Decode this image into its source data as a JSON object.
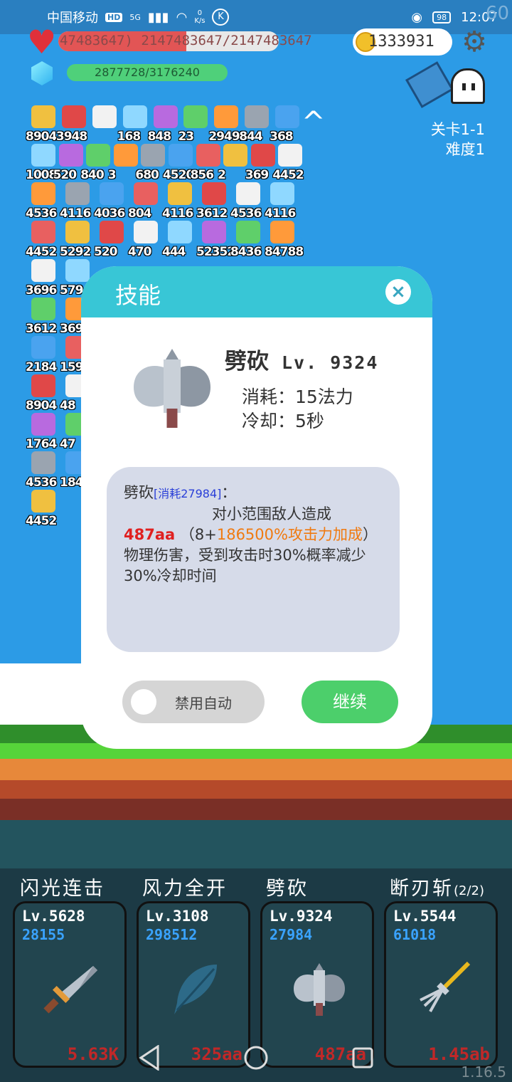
{
  "status_bar": {
    "carrier": "中国移动",
    "hd": "HD",
    "net": "5G",
    "speed": "0",
    "speed_unit": "K/s",
    "battery": "98",
    "time": "12:07",
    "fps": "60"
  },
  "hud": {
    "hp_text": "47483647) 2147483647/2147483647",
    "hp_fraction": 0.58,
    "mp_text": "2877728/3176240",
    "coins": "1333931",
    "stage": "关卡1-1",
    "difficulty": "难度1"
  },
  "inventory": [
    [
      "8904",
      "3948",
      "",
      "168",
      "848",
      "23",
      "29492",
      "844",
      "368"
    ],
    [
      "1008",
      "520",
      "840",
      "3",
      "680",
      "4520",
      "856",
      "2",
      "369",
      "4452"
    ],
    [
      "4536",
      "4116",
      "4036",
      "804",
      "4116",
      "3612",
      "4536",
      "4116"
    ],
    [
      "4452",
      "5292",
      "520",
      "470",
      "444",
      "52352",
      "8436",
      "84788"
    ],
    [
      "3696",
      "579"
    ],
    [
      "3612",
      "369"
    ],
    [
      "2184",
      "159"
    ],
    [
      "8904",
      "48"
    ],
    [
      "1764",
      "47"
    ],
    [
      "4536",
      "184"
    ],
    [
      "4452"
    ]
  ],
  "dialog": {
    "title": "技能",
    "skill_name": "劈砍",
    "skill_level": "Lv. 9324",
    "cost_line": "消耗：15法力",
    "cooldown_line": "冷却：5秒",
    "desc_name": "劈砍",
    "desc_cost": "[消耗27984]",
    "desc_colon": "：",
    "desc_line1": "对小范围敌人造成",
    "desc_dmg": "487aa",
    "desc_mid": "（8+",
    "desc_scale": "186500%攻击力加成",
    "desc_rest": "）物理伤害，受到攻击时30%概率减少30%冷却时间",
    "toggle_label": "禁用自动",
    "continue_label": "继续"
  },
  "skills": [
    {
      "label": "闪光连击",
      "sub": "",
      "level": "Lv.5628",
      "cost": "28155",
      "damage": "5.63K"
    },
    {
      "label": "风力全开",
      "sub": "",
      "level": "Lv.3108",
      "cost": "298512",
      "damage": "325aa"
    },
    {
      "label": "劈砍",
      "sub": "",
      "level": "Lv.9324",
      "cost": "27984",
      "damage": "487aa"
    },
    {
      "label": "断刃斩",
      "sub": "(2/2)",
      "level": "Lv.5544",
      "cost": "61018",
      "damage": "1.45ab"
    }
  ],
  "version": "1.16.5",
  "colors": {
    "accent": "#38c6d6",
    "continue": "#4ccf6b",
    "damage": "#e02020"
  }
}
